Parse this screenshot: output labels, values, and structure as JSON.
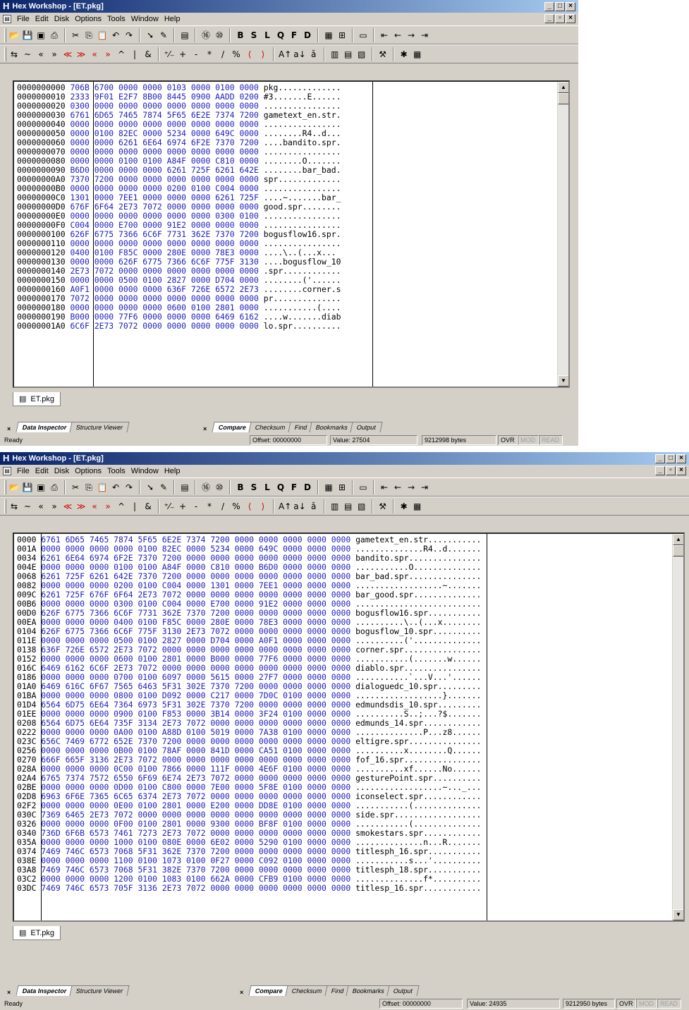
{
  "top": {
    "title": "Hex Workshop - [ET.pkg]",
    "menu": [
      "File",
      "Edit",
      "Disk",
      "Options",
      "Tools",
      "Window",
      "Help"
    ],
    "offsets": [
      "0000000000",
      "0000000010",
      "0000000020",
      "0000000030",
      "0000000040",
      "0000000050",
      "0000000060",
      "0000000070",
      "0000000080",
      "0000000090",
      "00000000A0",
      "00000000B0",
      "00000000C0",
      "00000000D0",
      "00000000E0",
      "00000000F0",
      "0000000100",
      "0000000110",
      "0000000120",
      "0000000130",
      "0000000140",
      "0000000150",
      "0000000160",
      "0000000170",
      "0000000180",
      "0000000190",
      "00000001A0"
    ],
    "bytes": [
      "706B 6700 0000 0000 0103 0000 0100 0000",
      "2333 9F01 E2F7 8B00 8445 0900 AADD 0200",
      "0300 0000 0000 0000 0000 0000 0000 0000",
      "6761 6D65 7465 7874 5F65 6E2E 7374 7200",
      "0000 0000 0000 0000 0000 0000 0000 0000",
      "0000 0100 82EC 0000 5234 0000 649C 0000",
      "0000 0000 6261 6E64 6974 6F2E 7370 7200",
      "0000 0000 0000 0000 0000 0000 0000 0000",
      "0000 0000 0100 0100 A84F 0000 C810 0000",
      "B6D0 0000 0000 0000 6261 725F 6261 642E",
      "7370 7200 0000 0000 0000 0000 0000 0000",
      "0000 0000 0000 0000 0200 0100 C004 0000",
      "1301 0000 7EE1 0000 0000 0000 6261 725F",
      "676F 6F64 2E73 7072 0000 0000 0000 0000",
      "0000 0000 0000 0000 0000 0000 0300 0100",
      "C004 0000 E700 0000 91E2 0000 0000 0000",
      "626F 6775 7366 6C6F 7731 362E 7370 7200",
      "0000 0000 0000 0000 0000 0000 0000 0000",
      "0400 0100 F85C 0000 280E 0000 78E3 0000",
      "0000 0000 626F 6775 7366 6C6F 775F 3130",
      "2E73 7072 0000 0000 0000 0000 0000 0000",
      "0000 0000 0500 0100 2827 0000 D704 0000",
      "A0F1 0000 0000 0000 636F 726E 6572 2E73",
      "7072 0000 0000 0000 0000 0000 0000 0000",
      "0000 0000 0000 0000 0600 0100 2801 0000",
      "B000 0000 77F6 0000 0000 0000 6469 6162",
      "6C6F 2E73 7072 0000 0000 0000 0000 0000"
    ],
    "ascii": [
      "pkg.............",
      "#3.......E......",
      "................",
      "gametext_en.str.",
      "................",
      "........R4..d...",
      "....bandito.spr.",
      "................",
      "........O.......",
      "........bar_bad.",
      "spr.............",
      "................",
      "....~.......bar_",
      "good.spr........",
      "................",
      "................",
      "bogusflow16.spr.",
      "................",
      "....\\..(...x...",
      "....bogusflow_10",
      ".spr............",
      "........('......",
      "........corner.s",
      "pr..............",
      "...........(....",
      "....w.......diab",
      "lo.spr.........."
    ],
    "doc_tab": "ET.pkg",
    "panel_left": [
      "Data Inspector",
      "Structure Viewer"
    ],
    "panel_right": [
      "Compare",
      "Checksum",
      "Find",
      "Bookmarks",
      "Output"
    ],
    "status": {
      "ready": "Ready",
      "offset": "Offset: 00000000",
      "value": "Value: 27504",
      "size": "9212998 bytes",
      "ovr": "OVR",
      "mod": "MOD",
      "read": "READ"
    }
  },
  "bottom": {
    "title": "Hex Workshop - [ET.pkg]",
    "menu": [
      "File",
      "Edit",
      "Disk",
      "Options",
      "Tools",
      "Window",
      "Help"
    ],
    "offsets": [
      "0000",
      "001A",
      "0034",
      "004E",
      "0068",
      "0082",
      "009C",
      "00B6",
      "00D0",
      "00EA",
      "0104",
      "011E",
      "0138",
      "0152",
      "016C",
      "0186",
      "01A0",
      "01BA",
      "01D4",
      "01EE",
      "0208",
      "0222",
      "023C",
      "0256",
      "0270",
      "028A",
      "02A4",
      "02BE",
      "02D8",
      "02F2",
      "030C",
      "0326",
      "0340",
      "035A",
      "0374",
      "038E",
      "03A8",
      "03C2",
      "03DC"
    ],
    "bytes": [
      "6761 6D65 7465 7874 5F65 6E2E 7374 7200 0000 0000 0000 0000 0000",
      "0000 0000 0000 0000 0100 82EC 0000 5234 0000 649C 0000 0000 0000",
      "6261 6E64 6974 6F2E 7370 7200 0000 0000 0000 0000 0000 0000 0000",
      "0000 0000 0000 0100 0100 A84F 0000 C810 0000 B6D0 0000 0000 0000",
      "6261 725F 6261 642E 7370 7200 0000 0000 0000 0000 0000 0000 0000",
      "0000 0000 0000 0200 0100 C004 0000 1301 0000 7EE1 0000 0000 0000",
      "6261 725F 676F 6F64 2E73 7072 0000 0000 0000 0000 0000 0000 0000",
      "0000 0000 0000 0300 0100 C004 0000 E700 0000 91E2 0000 0000 0000",
      "626F 6775 7366 6C6F 7731 362E 7370 7200 0000 0000 0000 0000 0000",
      "0000 0000 0000 0400 0100 F85C 0000 280E 0000 78E3 0000 0000 0000",
      "626F 6775 7366 6C6F 775F 3130 2E73 7072 0000 0000 0000 0000 0000",
      "0000 0000 0000 0500 0100 2827 0000 D704 0000 A0F1 0000 0000 0000",
      "636F 726E 6572 2E73 7072 0000 0000 0000 0000 0000 0000 0000 0000",
      "0000 0000 0000 0600 0100 2801 0000 B000 0000 77F6 0000 0000 0000",
      "6469 6162 6C6F 2E73 7072 0000 0000 0000 0000 0000 0000 0000 0000",
      "0000 0000 0000 0700 0100 6097 0000 5615 0000 27F7 0000 0000 0000",
      "6469 616C 6F67 7565 6463 5F31 302E 7370 7200 0000 0000 0000 0000",
      "0000 0000 0000 0800 0100 D092 0000 C217 0000 7D0C 0100 0000 0000",
      "6564 6D75 6E64 7364 6973 5F31 302E 7370 7200 0000 0000 0000 0000",
      "0000 0000 0000 0900 0100 F853 0000 3B14 0000 3F24 0100 0000 0000",
      "6564 6D75 6E64 735F 3134 2E73 7072 0000 0000 0000 0000 0000 0000",
      "0000 0000 0000 0A00 0100 A88D 0100 5019 0000 7A38 0100 0000 0000",
      "656C 7469 6772 652E 7370 7200 0000 0000 0000 0000 0000 0000 0000",
      "0000 0000 0000 0B00 0100 78AF 0000 841D 0000 CA51 0100 0000 0000",
      "666F 665F 3136 2E73 7072 0000 0000 0000 0000 0000 0000 0000 0000",
      "0000 0000 0000 0C00 0100 7866 0000 111F 0000 4E6F 0100 0000 0000",
      "6765 7374 7572 6550 6F69 6E74 2E73 7072 0000 0000 0000 0000 0000",
      "0000 0000 0000 0D00 0100 C800 0000 7E00 0000 5F8E 0100 0000 0000",
      "6963 6F6E 7365 6C65 6374 2E73 7072 0000 0000 0000 0000 0000 0000",
      "0000 0000 0000 0E00 0100 2801 0000 E200 0000 DD8E 0100 0000 0000",
      "7369 6465 2E73 7072 0000 0000 0000 0000 0000 0000 0000 0000 0000",
      "0000 0000 0000 0F00 0100 2801 0000 9300 0000 BF8F 0100 0000 0000",
      "736D 6F6B 6573 7461 7273 2E73 7072 0000 0000 0000 0000 0000 0000",
      "0000 0000 0000 1000 0100 080E 0000 6E02 0000 5290 0100 0000 0000",
      "7469 746C 6573 7068 5F31 362E 7370 7200 0000 0000 0000 0000 0000",
      "0000 0000 0000 1100 0100 1073 0100 0F27 0000 C092 0100 0000 0000",
      "7469 746C 6573 7068 5F31 382E 7370 7200 0000 0000 0000 0000 0000",
      "0000 0000 0000 1200 0100 1083 0100 662A 0000 CFB9 0100 0000 0000",
      "7469 746C 6573 705F 3136 2E73 7072 0000 0000 0000 0000 0000 0000"
    ],
    "ascii": [
      "gametext_en.str...........",
      "..............R4..d.......",
      "bandito.spr...............",
      "...........O..............",
      "bar_bad.spr...............",
      "..................~.......",
      "bar_good.spr..............",
      "..........................",
      "bogusflow16.spr...........",
      "..........\\..(...x........",
      "bogusflow_10.spr..........",
      "..........('..............",
      "corner.spr................",
      "...........(.......w......",
      "diablo.spr................",
      "...........`...V...'......",
      "dialoguedc_10.spr.........",
      "..................}.......",
      "edmundsdis_10.spr.........",
      "..........S..;...?$.......",
      "edmunds_14.spr............",
      "..............P...z8......",
      "eltigre.spr...............",
      "..........x........Q......",
      "fof_16.spr................",
      "..........xf......No......",
      "gesturePoint.spr..........",
      "..................~..._...",
      "iconselect.spr............",
      "...........(..............",
      "side.spr..................",
      "...........(..............",
      "smokestars.spr............",
      "..............n...R.......",
      "titlesph_16.spr...........",
      "...........s...'..........",
      "titlesph_18.spr...........",
      "..............f*..........",
      "titlesp_16.spr............"
    ],
    "doc_tab": "ET.pkg",
    "panel_left": [
      "Data Inspector",
      "Structure Viewer"
    ],
    "panel_right": [
      "Compare",
      "Checksum",
      "Find",
      "Bookmarks",
      "Output"
    ],
    "status": {
      "ready": "Ready",
      "offset": "Offset: 00000000",
      "value": "Value: 24935",
      "size": "9212950 bytes",
      "ovr": "OVR",
      "mod": "MOD",
      "read": "READ"
    }
  },
  "toolbar_glyphs": {
    "row1": [
      "B",
      "S",
      "L",
      "Q",
      "F",
      "D"
    ],
    "row2": [
      "~",
      "«",
      "»",
      "&",
      "+",
      "-",
      "*",
      "/",
      "%",
      "^",
      "|"
    ]
  }
}
